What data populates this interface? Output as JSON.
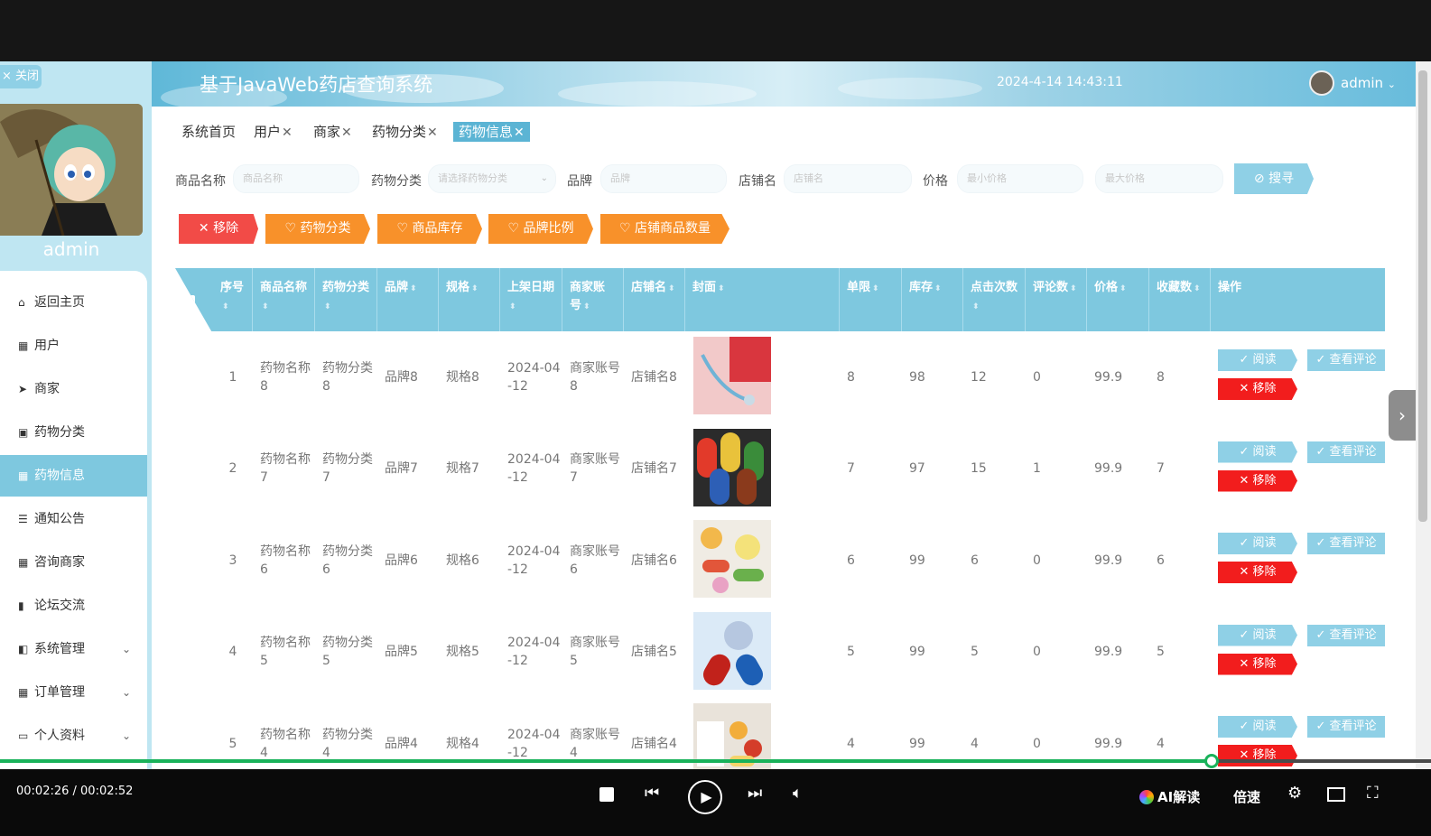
{
  "sidebar": {
    "close_label": "× 关闭",
    "username": "admin",
    "menu": [
      {
        "icon": "⌂",
        "label": "返回主页",
        "expandable": false,
        "active": false
      },
      {
        "icon": "▦",
        "label": "用户",
        "expandable": false,
        "active": false
      },
      {
        "icon": "➤",
        "label": "商家",
        "expandable": false,
        "active": false
      },
      {
        "icon": "▣",
        "label": "药物分类",
        "expandable": false,
        "active": false
      },
      {
        "icon": "▦",
        "label": "药物信息",
        "expandable": false,
        "active": true
      },
      {
        "icon": "☰",
        "label": "通知公告",
        "expandable": false,
        "active": false
      },
      {
        "icon": "▦",
        "label": "咨询商家",
        "expandable": false,
        "active": false
      },
      {
        "icon": "▮",
        "label": "论坛交流",
        "expandable": false,
        "active": false
      },
      {
        "icon": "◧",
        "label": "系统管理",
        "expandable": true,
        "active": false
      },
      {
        "icon": "▦",
        "label": "订单管理",
        "expandable": true,
        "active": false
      },
      {
        "icon": "▭",
        "label": "个人资料",
        "expandable": true,
        "active": false
      }
    ]
  },
  "header": {
    "title": "基于JavaWeb药店查询系统",
    "datetime": "2024-4-14 14:43:11",
    "user": "admin"
  },
  "tabs": [
    {
      "label": "系统首页",
      "closable": false,
      "active": false
    },
    {
      "label": "用户",
      "closable": true,
      "active": false
    },
    {
      "label": "商家",
      "closable": true,
      "active": false
    },
    {
      "label": "药物分类",
      "closable": true,
      "active": false
    },
    {
      "label": "药物信息",
      "closable": true,
      "active": true
    }
  ],
  "search": {
    "fields": [
      {
        "label": "商品名称",
        "placeholder": "商品名称"
      },
      {
        "label": "药物分类",
        "placeholder": "请选择药物分类"
      },
      {
        "label": "品牌",
        "placeholder": "品牌"
      },
      {
        "label": "店铺名",
        "placeholder": "店铺名"
      },
      {
        "label": "价格",
        "placeholder": "最小价格"
      },
      {
        "label": "",
        "placeholder": "最大价格"
      }
    ],
    "button": "⊘ 搜寻"
  },
  "actions": [
    {
      "label": "✕ 移除",
      "color": "#f24b47"
    },
    {
      "label": "♡ 药物分类",
      "color": "#f8912a"
    },
    {
      "label": "♡ 商品库存",
      "color": "#f8912a"
    },
    {
      "label": "♡ 品牌比例",
      "color": "#f8912a"
    },
    {
      "label": "♡ 店铺商品数量",
      "color": "#f8912a"
    }
  ],
  "table": {
    "headers": [
      "序号",
      "商品名称",
      "药物分类",
      "品牌",
      "规格",
      "上架日期",
      "商家账号",
      "店铺名",
      "封面",
      "单限",
      "库存",
      "点击次数",
      "评论数",
      "价格",
      "收藏数",
      "操作"
    ],
    "rows": [
      {
        "no": "1",
        "name": "药物名称8",
        "category": "药物分类8",
        "brand": "品牌8",
        "spec": "规格8",
        "date": "2024-04-12",
        "merchant": "商家账号8",
        "shop": "店铺名8",
        "cover": "stethoscope-image",
        "limit": "8",
        "stock": "98",
        "clicks": "12",
        "comments": "0",
        "price": "99.9",
        "favorites": "8"
      },
      {
        "no": "2",
        "name": "药物名称7",
        "category": "药物分类7",
        "brand": "品牌7",
        "spec": "规格7",
        "date": "2024-04-12",
        "merchant": "商家账号7",
        "shop": "店铺名7",
        "cover": "capsules-image",
        "limit": "7",
        "stock": "97",
        "clicks": "15",
        "comments": "1",
        "price": "99.9",
        "favorites": "7"
      },
      {
        "no": "3",
        "name": "药物名称6",
        "category": "药物分类6",
        "brand": "品牌6",
        "spec": "规格6",
        "date": "2024-04-12",
        "merchant": "商家账号6",
        "shop": "店铺名6",
        "cover": "pills-image",
        "limit": "6",
        "stock": "99",
        "clicks": "6",
        "comments": "0",
        "price": "99.9",
        "favorites": "6"
      },
      {
        "no": "4",
        "name": "药物名称5",
        "category": "药物分类5",
        "brand": "品牌5",
        "spec": "规格5",
        "date": "2024-04-12",
        "merchant": "商家账号5",
        "shop": "店铺名5",
        "cover": "capsule-split-image",
        "limit": "5",
        "stock": "99",
        "clicks": "5",
        "comments": "0",
        "price": "99.9",
        "favorites": "5"
      },
      {
        "no": "5",
        "name": "药物名称4",
        "category": "药物分类4",
        "brand": "品牌4",
        "spec": "规格4",
        "date": "2024-04-12",
        "merchant": "商家账号4",
        "shop": "店铺名4",
        "cover": "pill-bottle-image",
        "limit": "4",
        "stock": "99",
        "clicks": "4",
        "comments": "0",
        "price": "99.9",
        "favorites": "4"
      }
    ],
    "op_read": "✓ 阅读",
    "op_review": "✓ 查看评论",
    "op_remove": "✕ 移除"
  },
  "player": {
    "time": "00:02:26 / 00:02:52",
    "progress": 0.847,
    "ai_label": "AI解读",
    "speed_label": "倍速"
  },
  "colors": {
    "accent": "#7ec8df",
    "remove": "#f21d1d",
    "orange": "#f8912a",
    "progress": "#19b25a"
  }
}
